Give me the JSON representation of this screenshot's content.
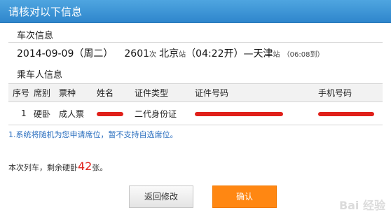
{
  "dialog": {
    "title": "请核对以下信息"
  },
  "train_section": {
    "label": "车次信息",
    "date": "2014-09-09（周二）",
    "train_no": "2601",
    "train_suffix": "次",
    "from_station": "北京",
    "from_station_suffix": "站",
    "depart_time": "（04:22开）",
    "separator": "—",
    "to_station": "天津",
    "to_station_suffix": "站",
    "arrive_time": "（06:08到）"
  },
  "passenger_section": {
    "label": "乘车人信息",
    "columns": [
      "序号",
      "席别",
      "票种",
      "姓名",
      "证件类型",
      "证件号码",
      "手机号码"
    ],
    "rows": [
      {
        "index": "1",
        "seat": "硬卧",
        "ticket_type": "成人票",
        "id_type": "二代身份证"
      }
    ]
  },
  "notice": "1.系统将随机为您申请席位，暂不支持自选席位。",
  "remaining": {
    "prefix": "本次列车，剩余硬卧",
    "count": "42",
    "suffix": "张。"
  },
  "buttons": {
    "back": "返回修改",
    "confirm": "确认"
  },
  "watermark": "Bai 经验",
  "colors": {
    "titlebar": "#2f86cc",
    "confirm": "#ff8712",
    "notice": "#2b6fbf",
    "count": "#e0201a"
  }
}
